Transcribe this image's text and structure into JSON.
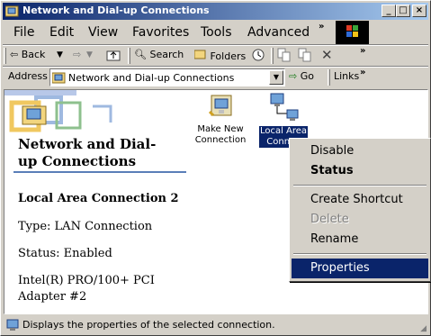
{
  "window": {
    "title": "Network and Dial-up Connections",
    "icon": "network-folder-icon",
    "buttons": {
      "minimize": "_",
      "maximize": "□",
      "close": "×"
    }
  },
  "menubar": {
    "items": [
      "File",
      "Edit",
      "View",
      "Favorites",
      "Tools",
      "Advanced"
    ],
    "chevron": "»"
  },
  "toolbar": {
    "back": "Back",
    "search": "Search",
    "folders": "Folders",
    "chevron": "»"
  },
  "addressbar": {
    "label": "Address",
    "value": "Network and Dial-up Connections",
    "go": "Go",
    "links": "Links",
    "chevron": "»"
  },
  "webview": {
    "title_line1": "Network and Dial-",
    "title_line2": "up Connections",
    "connection_name": "Local Area Connection 2",
    "type": "Type: LAN Connection",
    "status": "Status: Enabled",
    "device_line1": "Intel(R) PRO/100+ PCI",
    "device_line2": "Adapter #2"
  },
  "files": [
    {
      "label_line1": "Make New",
      "label_line2": "Connection",
      "icon": "make-new-connection-icon",
      "selected": false
    },
    {
      "label_line1": "Local Area",
      "label_line2": "Connec",
      "icon": "local-area-connection-icon",
      "selected": true
    }
  ],
  "context_menu": {
    "items": [
      {
        "label": "Disable",
        "style": "normal"
      },
      {
        "label": "Status",
        "style": "bold"
      },
      {
        "label": "Create Shortcut",
        "style": "normal"
      },
      {
        "label": "Delete",
        "style": "disabled"
      },
      {
        "label": "Rename",
        "style": "normal"
      },
      {
        "label": "Properties",
        "style": "highlighted"
      }
    ]
  },
  "statusbar": {
    "text": "Displays the properties of the selected connection."
  },
  "colors": {
    "title_gradient_start": "#0a246a",
    "title_gradient_end": "#a6caf0",
    "selection": "#0a246a",
    "face": "#d4d0c8"
  }
}
